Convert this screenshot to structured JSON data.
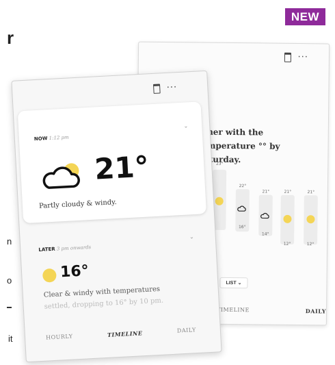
{
  "badge": {
    "label": "NEW",
    "color": "#8e2a9a"
  },
  "edge_text": {
    "r": "r",
    "n": "n",
    "o": "o",
    "it": "it"
  },
  "toolbar": {
    "delete_icon": "trash-icon",
    "more_label": "···"
  },
  "back_card": {
    "heading_fragment": "s",
    "summary": "ather with the temperature °° by Saturday.",
    "columns": [
      {
        "high": "23°",
        "icon": "sun",
        "low": ""
      },
      {
        "high": "22°",
        "icon": "cloud",
        "low": "16°"
      },
      {
        "high": "21°",
        "icon": "cloud",
        "low": "14°"
      },
      {
        "high": "21°",
        "icon": "sun",
        "low": "12°"
      },
      {
        "high": "21°",
        "icon": "sun",
        "low": "12°"
      }
    ],
    "list_button": "LIST ⌄",
    "tabs": {
      "timeline": "TIMELINE",
      "daily": "DAILY"
    }
  },
  "front_card": {
    "now": {
      "label": "NOW",
      "time": "1:12 pm",
      "temp": "21°",
      "icon": "partly-cloudy-icon",
      "description": "Partly cloudy & windy."
    },
    "later": {
      "label": "LATER",
      "time": "3 pm onwards",
      "temp": "16°",
      "icon": "sun-icon",
      "description_line1": "Clear & windy with temperatures",
      "description_line2": "settled, dropping to 16° by 10 pm."
    },
    "tabs": {
      "hourly": "HOURLY",
      "timeline": "TIMELINE",
      "daily": "DAILY"
    }
  },
  "colors": {
    "sun": "#f4d556",
    "badge": "#8e2a9a"
  }
}
